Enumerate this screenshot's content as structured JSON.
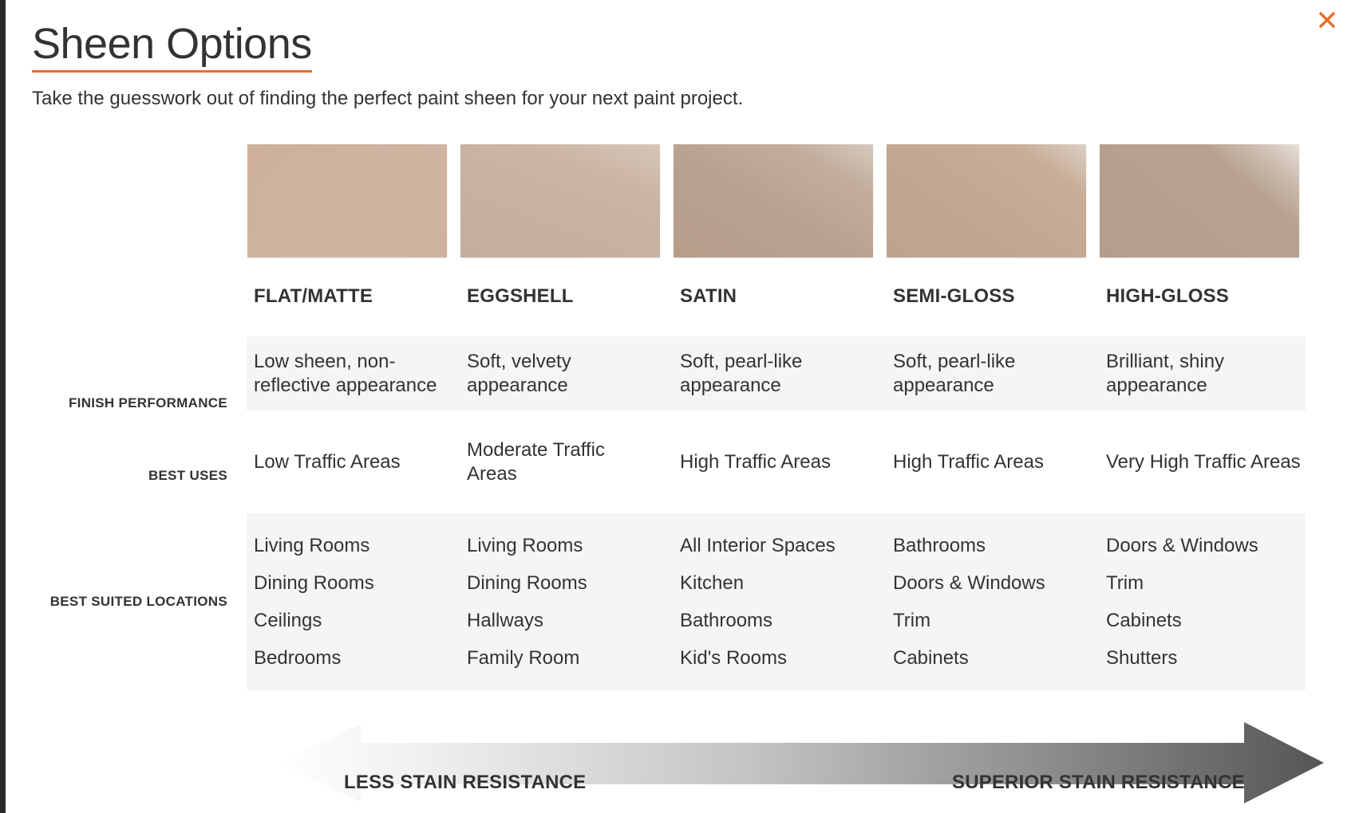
{
  "modal": {
    "title": "Sheen Options",
    "subtitle": "Take the guesswork out of finding the perfect paint sheen for your next paint project.",
    "close_icon": "close-icon",
    "accent_color": "#e8702a"
  },
  "columns": [
    {
      "name": "FLAT/MATTE",
      "swatch_color": "#cdb09c",
      "finish": "Low sheen, non-reflective appearance",
      "uses": "Low Traffic Areas",
      "locations": [
        "Living Rooms",
        "Dining Rooms",
        "Ceilings",
        "Bedrooms"
      ]
    },
    {
      "name": "EGGSHELL",
      "swatch_color": "#c9b3a2",
      "finish": "Soft, velvety appearance",
      "uses": "Moderate Traffic Areas",
      "locations": [
        "Living Rooms",
        "Dining Rooms",
        "Hallways",
        "Family Room"
      ]
    },
    {
      "name": "SATIN",
      "swatch_color": "#b9a28f",
      "finish": "Soft, pearl-like appearance",
      "uses": "High Traffic Areas",
      "locations": [
        "All Interior Spaces",
        "Kitchen",
        "Bathrooms",
        "Kid's Rooms"
      ]
    },
    {
      "name": "SEMI-GLOSS",
      "swatch_color": "#c2a994",
      "finish": "Soft, pearl-like appearance",
      "uses": "High Traffic Areas",
      "locations": [
        "Bathrooms",
        "Doors & Windows",
        "Trim",
        "Cabinets"
      ]
    },
    {
      "name": "HIGH-GLOSS",
      "swatch_color": "#b6a08e",
      "finish": "Brilliant, shiny appearance",
      "uses": "Very High Traffic Areas",
      "locations": [
        "Doors & Windows",
        "Trim",
        "Cabinets",
        "Shutters"
      ]
    }
  ],
  "row_labels": {
    "finish": "FINISH PERFORMANCE",
    "uses": "BEST USES",
    "locations": "BEST SUITED LOCATIONS"
  },
  "stain_scale": {
    "left_label": "LESS STAIN RESISTANCE",
    "right_label": "SUPERIOR STAIN RESISTANCE"
  }
}
